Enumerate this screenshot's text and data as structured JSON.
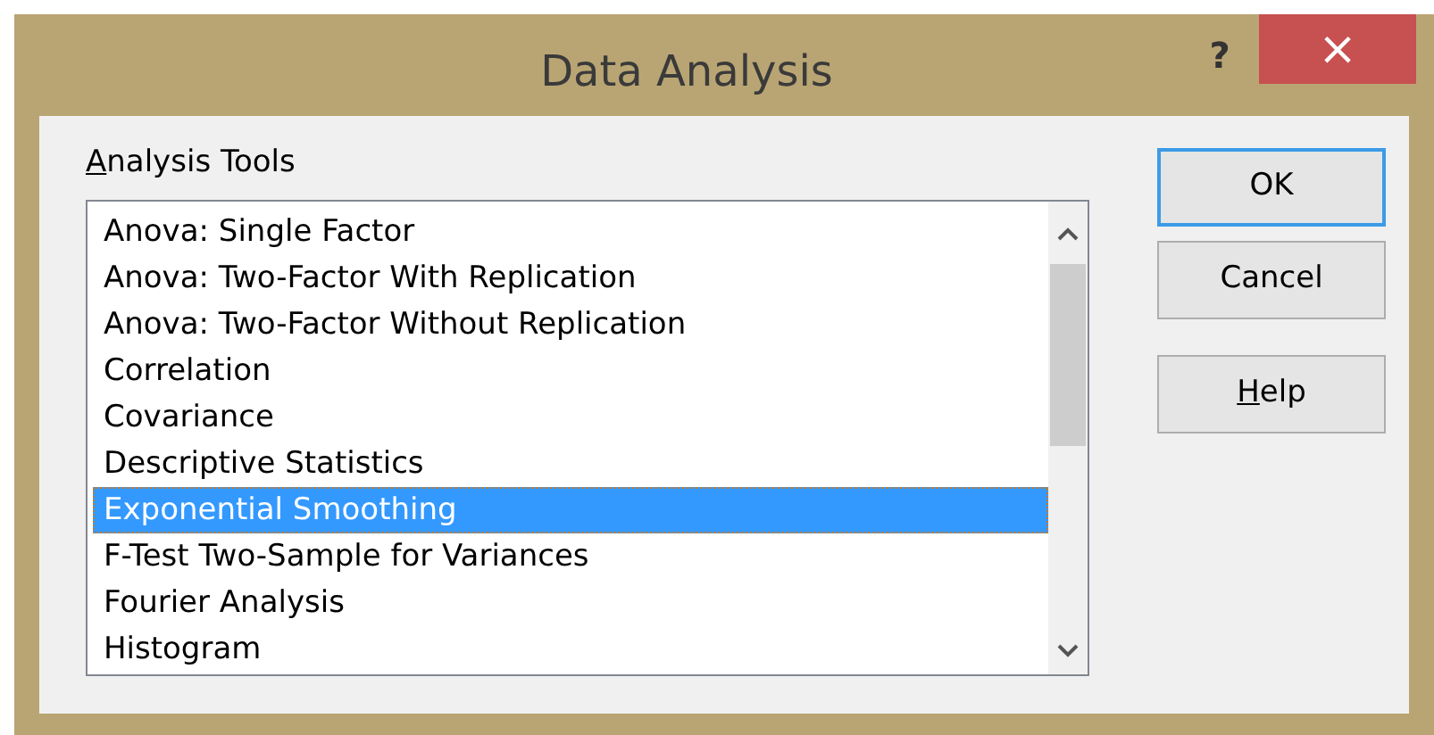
{
  "window": {
    "title": "Data Analysis",
    "help_glyph": "?",
    "close_glyph": "×"
  },
  "list_label": {
    "text": "Analysis Tools",
    "underline_first": true
  },
  "tools": [
    {
      "label": "Anova: Single Factor",
      "selected": false
    },
    {
      "label": "Anova: Two-Factor With Replication",
      "selected": false
    },
    {
      "label": "Anova: Two-Factor Without Replication",
      "selected": false
    },
    {
      "label": "Correlation",
      "selected": false
    },
    {
      "label": "Covariance",
      "selected": false
    },
    {
      "label": "Descriptive Statistics",
      "selected": false
    },
    {
      "label": "Exponential Smoothing",
      "selected": true
    },
    {
      "label": "F-Test Two-Sample for Variances",
      "selected": false
    },
    {
      "label": "Fourier Analysis",
      "selected": false
    },
    {
      "label": "Histogram",
      "selected": false
    }
  ],
  "buttons": [
    {
      "label": "OK",
      "default": true,
      "underline_first": false
    },
    {
      "label": "Cancel",
      "default": false,
      "underline_first": false
    },
    {
      "label": "Help",
      "default": false,
      "underline_first": true
    }
  ]
}
